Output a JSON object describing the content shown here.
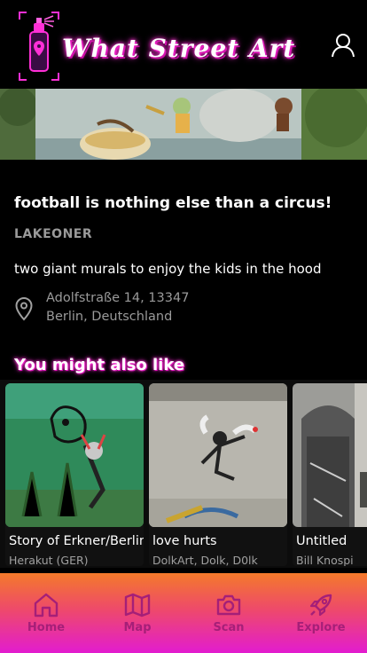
{
  "header": {
    "app_title": "What Street Art",
    "logo_icon": "spray-can-icon",
    "profile_icon": "user-icon"
  },
  "artwork": {
    "title": "football is nothing else than a circus!",
    "artist": "LAKEONER",
    "description": "two giant murals to enjoy the kids in the hood",
    "address_line1": "Adolfstraße 14, 13347",
    "address_line2": "Berlin, Deutschland",
    "location_icon": "map-pin-icon"
  },
  "related": {
    "section_title": "You might also like",
    "cards": [
      {
        "title": "Story of Erkner/Berlin",
        "artist": "Herakut (GER)"
      },
      {
        "title": "love hurts",
        "artist": "DolkArt, Dolk, D0lk"
      },
      {
        "title": "Untitled",
        "artist": "Bill Knospi"
      }
    ]
  },
  "nav": {
    "items": [
      {
        "label": "Home",
        "icon": "home-icon"
      },
      {
        "label": "Map",
        "icon": "map-icon"
      },
      {
        "label": "Scan",
        "icon": "camera-icon"
      },
      {
        "label": "Explore",
        "icon": "rocket-icon"
      }
    ]
  },
  "colors": {
    "accent_pink": "#ff2fd6",
    "nav_gradient_top": "#f47a2a",
    "nav_gradient_bottom": "#e21ccf",
    "nav_label": "#a51f78",
    "muted_text": "#9a9a9a"
  }
}
